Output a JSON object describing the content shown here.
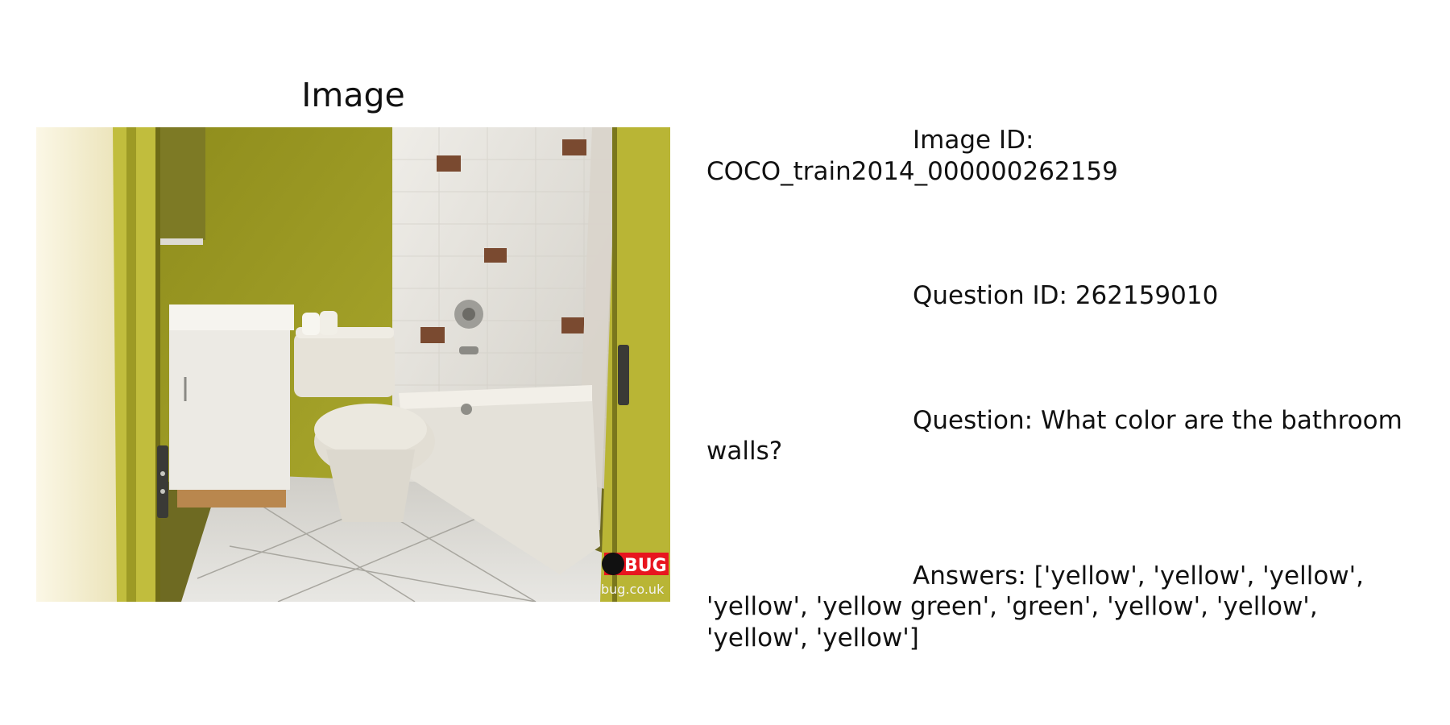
{
  "panel": {
    "title": "Image"
  },
  "photo": {
    "watermark_brand": "BUG",
    "watermark_site": "bug.co.uk",
    "colors": {
      "wall": "#a7a525",
      "door_frame": "#c5c24a",
      "tile": "#e6e3dc",
      "floor": "#d9d7d2",
      "fixture": "#e9e6de",
      "logo_red": "#e8161f"
    }
  },
  "info": {
    "image_id": "Image ID:\nCOCO_train2014_000000262159",
    "question_id": "Question ID: 262159010",
    "question": "Question: What color are the bathroom\nwalls?",
    "answers": "Answers: ['yellow', 'yellow', 'yellow',\n'yellow', 'yellow green', 'green', 'yellow', 'yellow',\n'yellow', 'yellow']"
  }
}
